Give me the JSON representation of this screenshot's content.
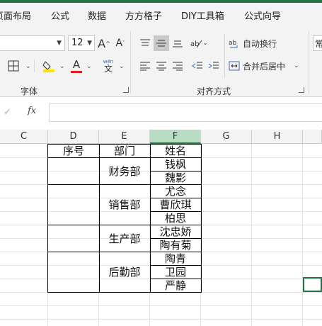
{
  "tabs": [
    "页面布局",
    "公式",
    "数据",
    "方方格子",
    "DIY工具箱",
    "公式向导"
  ],
  "tab_page_layout_visible": "页面布局",
  "ribbon": {
    "font_size": "12",
    "font_group_label": "字体",
    "align_group_label": "对齐方式",
    "wrap_text": "自动换行",
    "merge_center": "合并后居中",
    "phonetic": "wén",
    "right_edge_text": "常",
    "colors": {
      "highlight": "#ffe600",
      "font_red": "#e02020",
      "accent": "#217346"
    }
  },
  "formula_bar": {
    "fx": "fx",
    "check": "✓"
  },
  "columns": [
    "C",
    "D",
    "E",
    "F",
    "G",
    "H"
  ],
  "selected_column": "F",
  "table": {
    "headers": {
      "seq": "序号",
      "dept": "部门",
      "name": "姓名"
    },
    "departments": [
      "财务部",
      "销售部",
      "生产部",
      "后勤部"
    ],
    "names": [
      "钱枫",
      "魏影",
      "尤念",
      "曹欣琪",
      "柏思",
      "沈忠娇",
      "陶有菊",
      "陶青",
      "卫园",
      "严静"
    ]
  }
}
